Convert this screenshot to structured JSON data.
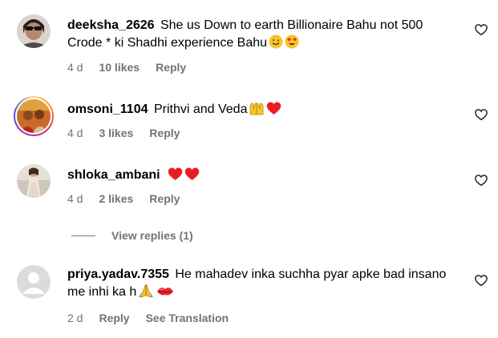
{
  "comments": [
    {
      "username": "deeksha_2626",
      "text": "She us Down to earth Billionaire Bahu not 500 Crode * ki Shadhi experience Bahu",
      "emojis": [
        "smiling-face-icon",
        "heart-eyes-face-icon"
      ],
      "time": "4 d",
      "likes": "10 likes",
      "reply_label": "Reply",
      "avatar": "profile-photo-sunglasses"
    },
    {
      "username": "omsoni_1104",
      "text": "Prithvi and Veda",
      "emojis": [
        "raising-hands-icon",
        "red-heart-icon"
      ],
      "time": "4 d",
      "likes": "3 likes",
      "reply_label": "Reply",
      "avatar": "profile-photo-story-ring"
    },
    {
      "username": "shloka_ambani",
      "text": "",
      "emojis": [
        "red-heart-icon",
        "red-heart-icon"
      ],
      "time": "4 d",
      "likes": "2 likes",
      "reply_label": "Reply",
      "avatar": "profile-photo-dress"
    },
    {
      "username": "priya.yadav.7355",
      "text": "He mahadev inka suchha pyar apke bad insano me inhi ka h",
      "emojis": [
        "folded-hands-icon",
        "kiss-lips-icon"
      ],
      "time": "2 d",
      "reply_label": "Reply",
      "see_translation": "See Translation",
      "avatar": "default-avatar"
    }
  ],
  "view_replies": "View replies (1)",
  "colors": {
    "text": "#000000",
    "meta": "#737373",
    "heart": "#ed1c24"
  }
}
